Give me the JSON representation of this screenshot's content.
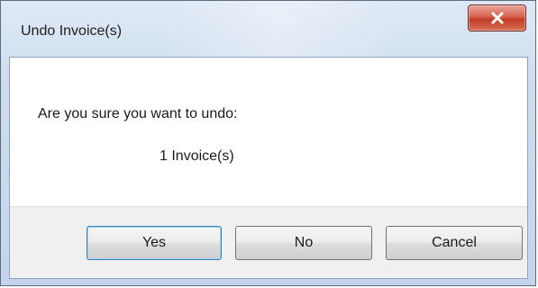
{
  "window": {
    "title": "Undo Invoice(s)"
  },
  "message": {
    "prompt": "Are you sure you want to undo:",
    "detail": "1 Invoice(s)"
  },
  "buttons": {
    "yes_label": "Yes",
    "no_label": "No",
    "cancel_label": "Cancel"
  },
  "icons": {
    "close": "close-icon"
  },
  "colors": {
    "close_button": "#c84a35",
    "titlebar": "#cdddef",
    "button_bar": "#f0f0f0"
  }
}
